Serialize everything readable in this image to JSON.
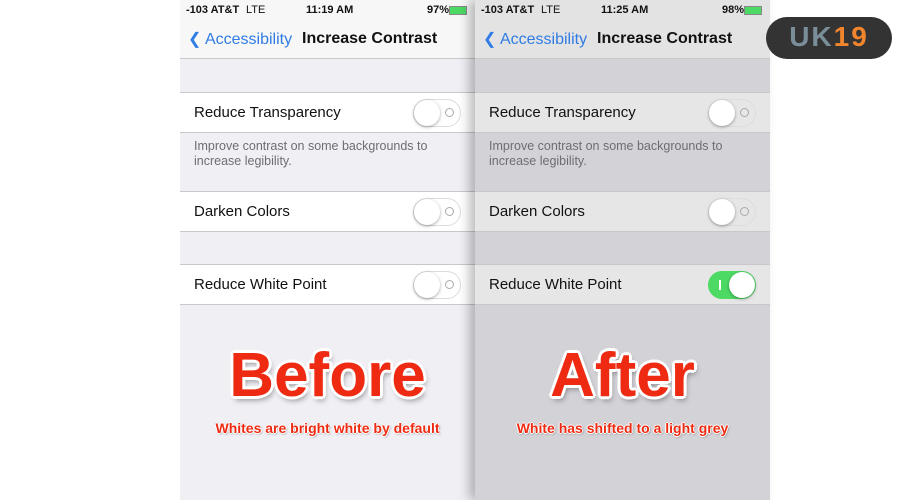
{
  "panels": [
    {
      "status": {
        "carrier": "-103 AT&T",
        "network": "LTE",
        "time": "11:19 AM",
        "battery": "97%"
      },
      "nav": {
        "back": "Accessibility",
        "title": "Increase Contrast"
      },
      "settings": [
        {
          "label": "Reduce Transparency",
          "on": false
        },
        {
          "label": "Darken Colors",
          "on": false
        },
        {
          "label": "Reduce White Point",
          "on": false
        }
      ],
      "description": "Improve contrast on some backgrounds to increase legibility.",
      "caption": "Before",
      "subcaption": "Whites are bright white by default"
    },
    {
      "status": {
        "carrier": "-103 AT&T",
        "network": "LTE",
        "time": "11:25 AM",
        "battery": "98%"
      },
      "nav": {
        "back": "Accessibility",
        "title": "Increase Contrast"
      },
      "settings": [
        {
          "label": "Reduce Transparency",
          "on": false
        },
        {
          "label": "Darken Colors",
          "on": false
        },
        {
          "label": "Reduce White Point",
          "on": true
        }
      ],
      "description": "Improve contrast on some backgrounds to increase legibility.",
      "caption": "After",
      "subcaption": "White has shifted to a light grey"
    }
  ],
  "logo": {
    "text_a": "UK",
    "text_b": "19"
  },
  "colors": {
    "accent": "#2f7ce4",
    "toggle_on": "#4cd964",
    "caption": "#ee2b12"
  }
}
